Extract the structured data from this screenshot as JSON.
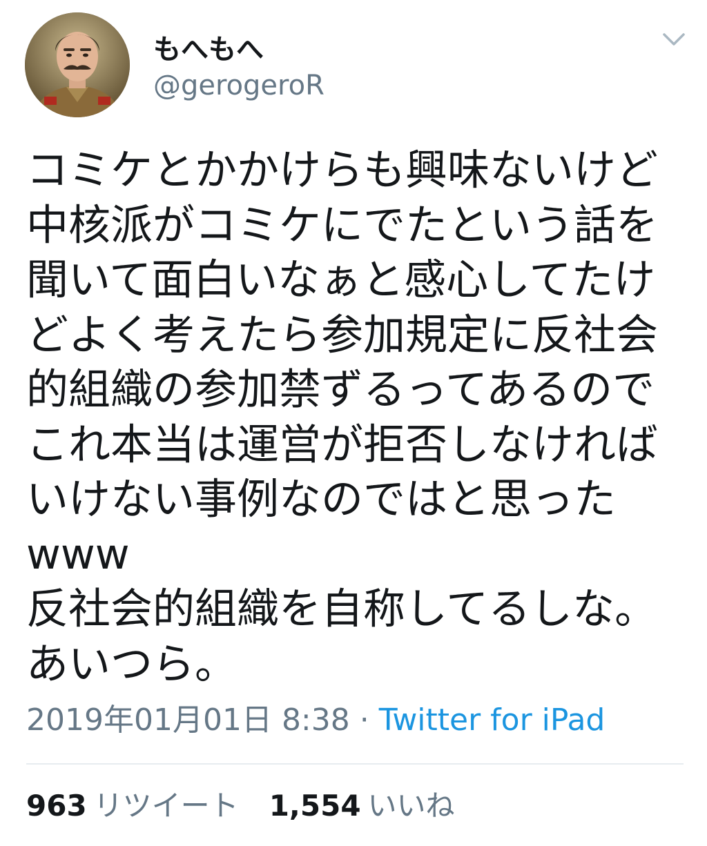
{
  "user": {
    "display_name": "もへもへ",
    "handle": "@gerogeroR"
  },
  "menu": {
    "icon": "chevron-down-icon"
  },
  "tweet": {
    "text": "コミケとかかけらも興味ないけど\n中核派がコミケにでたという話を\n聞いて面白いなぁと感心してたけ\nどよく考えたら参加規定に反社会\n的組織の参加禁ずるってあるので\nこれ本当は運営が拒否しなければ\nいけない事例なのではと思った\nwww\n反社会的組織を自称してるしな。\nあいつら。",
    "timestamp": "2019年01月01日 8:38",
    "separator": " · ",
    "source": "Twitter for iPad"
  },
  "stats": {
    "retweets_count": "963",
    "retweets_label": "リツイート",
    "likes_count": "1,554",
    "likes_label": "いいね"
  },
  "colors": {
    "text": "#14171a",
    "secondary": "#657786",
    "link": "#1b95e0",
    "divider": "#e6ecf0"
  }
}
